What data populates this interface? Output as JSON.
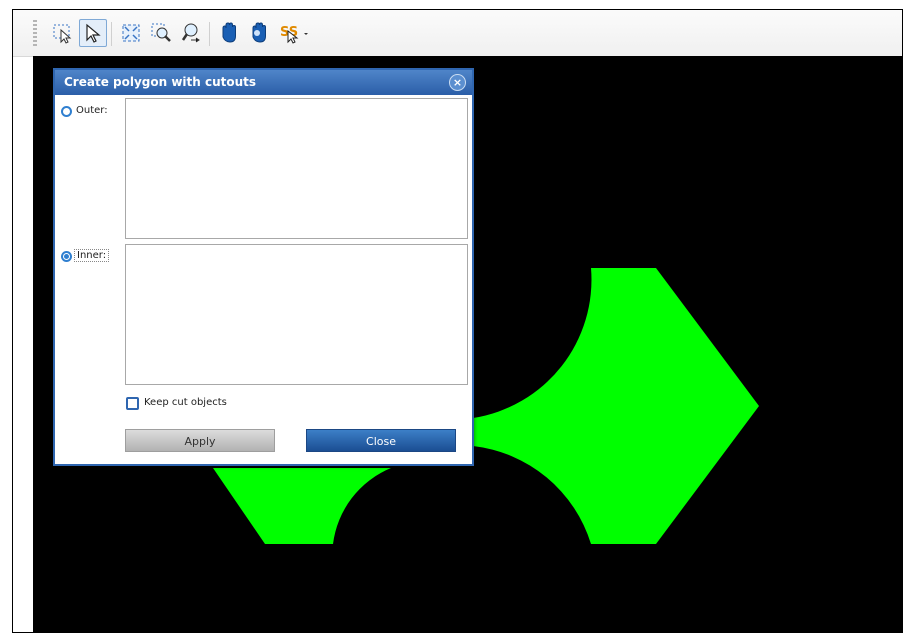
{
  "toolbar": {
    "icons": [
      "lasso-select-icon",
      "select-arrow-icon",
      "zoom-extents-icon",
      "zoom-window-icon",
      "zoom-realtime-icon",
      "pan-hand-icon",
      "pan-realtime-icon",
      "snap-dropdown-icon"
    ],
    "active": "select-arrow-icon",
    "snap_label": "SS"
  },
  "dialog": {
    "title": "Create polygon with cutouts",
    "close_glyph": "×",
    "outer_label": "Outer:",
    "inner_label": "Inner:",
    "selected": "inner",
    "keep_cut_objects_label": "Keep cut objects",
    "keep_cut_objects_checked": false,
    "apply_label": "Apply",
    "close_label": "Close"
  },
  "colors": {
    "canvas": "#000000",
    "shape": "#00ff00",
    "title_bar": "#2f66b0",
    "accent": "#2f7fd0"
  }
}
